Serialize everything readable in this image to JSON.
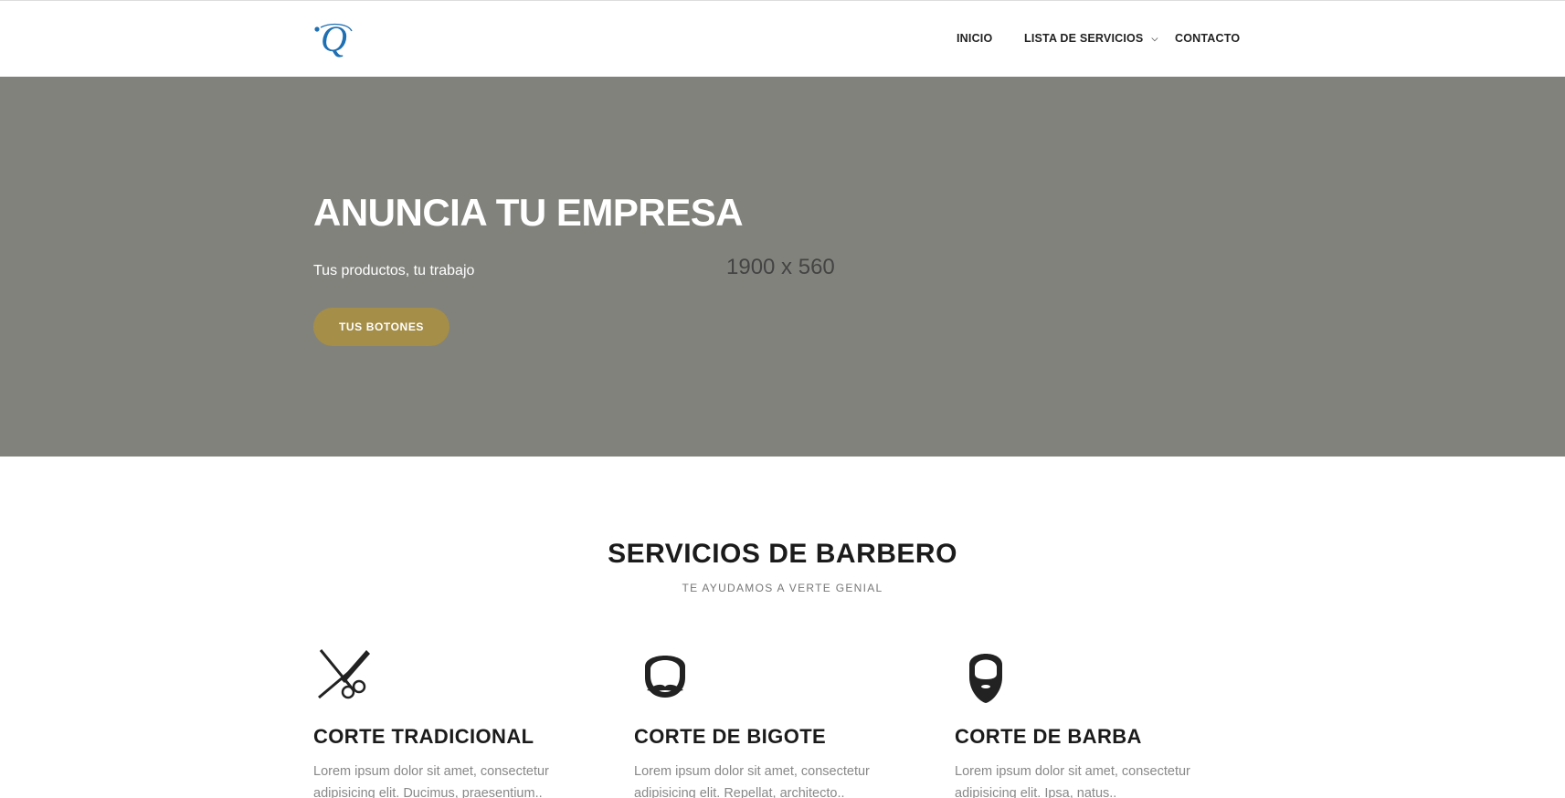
{
  "nav": {
    "logo_alt": "Q",
    "items": [
      {
        "label": "INICIO"
      },
      {
        "label": "LISTA DE SERVICIOS",
        "has_dropdown": true
      },
      {
        "label": "CONTACTO"
      }
    ]
  },
  "hero": {
    "title": "ANUNCIA TU EMPRESA",
    "subtitle": "Tus productos, tu trabajo",
    "placeholder_label": "1900 x 560",
    "button_label": "TUS BOTONES",
    "background_color": "#82827d",
    "button_color": "#a58e47"
  },
  "services_section": {
    "title": "SERVICIOS DE BARBERO",
    "subtitle": "TE AYUDAMOS A VERTE GENIAL",
    "items": [
      {
        "icon": "scissors-comb-icon",
        "title": "CORTE TRADICIONAL",
        "text": "Lorem ipsum dolor sit amet, consectetur adipisicing elit. Ducimus, praesentium.."
      },
      {
        "icon": "mustache-face-icon",
        "title": "CORTE DE BIGOTE",
        "text": "Lorem ipsum dolor sit amet, consectetur adipisicing elit. Repellat, architecto.."
      },
      {
        "icon": "beard-face-icon",
        "title": "CORTE DE BARBA",
        "text": "Lorem ipsum dolor sit amet, consectetur adipisicing elit. Ipsa, natus.."
      }
    ]
  }
}
